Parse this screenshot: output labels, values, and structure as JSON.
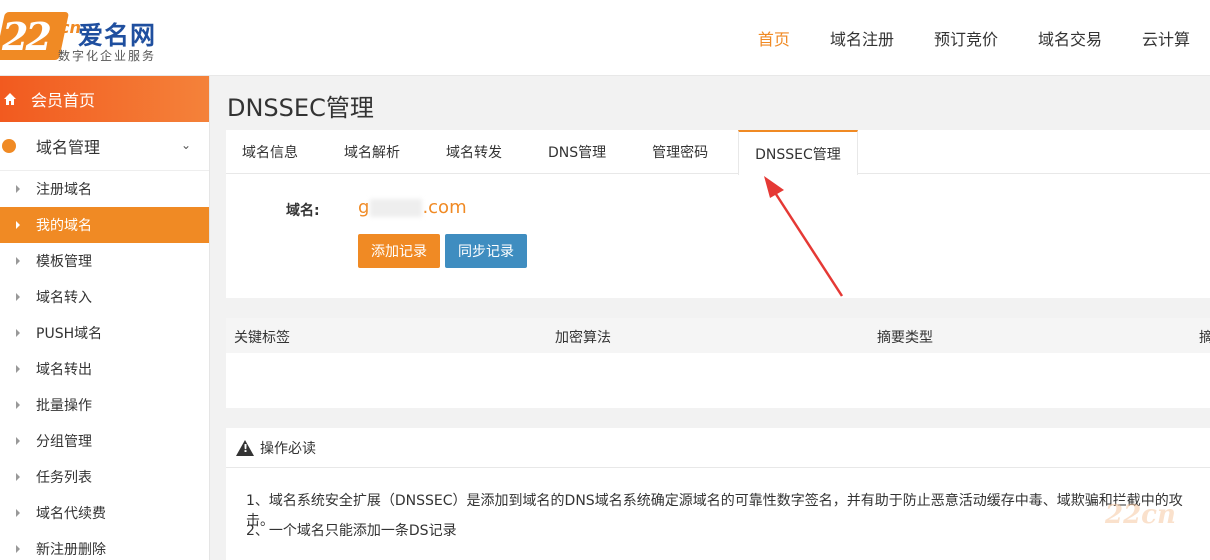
{
  "header": {
    "logo_number": "22",
    "logo_cn": "cn",
    "logo_brand": "爱名网",
    "logo_slogan": "数字化企业服务",
    "nav": [
      "首页",
      "域名注册",
      "预订竞价",
      "域名交易",
      "云计算"
    ],
    "nav_active": "首页"
  },
  "sidebar": {
    "home_label": "会员首页",
    "group_label": "域名管理",
    "items": [
      "注册域名",
      "我的域名",
      "模板管理",
      "域名转入",
      "PUSH域名",
      "域名转出",
      "批量操作",
      "分组管理",
      "任务列表",
      "域名代续费",
      "新注册删除"
    ],
    "active_item": "我的域名"
  },
  "main": {
    "page_title": "DNSSEC管理",
    "tabs": [
      "域名信息",
      "域名解析",
      "域名转发",
      "DNS管理",
      "管理密码",
      "DNSSEC管理"
    ],
    "active_tab": "DNSSEC管理",
    "domain_label": "域名:",
    "domain_prefix": "g",
    "domain_suffix": ".com",
    "add_button": "添加记录",
    "sync_button": "同步记录",
    "table_headers": [
      "关键标签",
      "加密算法",
      "摘要类型",
      "摘"
    ],
    "notice_title": "操作必读",
    "notice_lines": [
      "1、域名系统安全扩展（DNSSEC）是添加到域名的DNS域名系统确定源域名的可靠性数字签名，并有助于防止恶意活动缓存中毒、域欺骗和拦截中的攻击。",
      "2、一个域名只能添加一条DS记录"
    ]
  },
  "watermark": "22cn",
  "colors": {
    "accent": "#f08a24",
    "sync_button": "#3f8dc0",
    "brand_blue": "#1f4f9f",
    "annotation_arrow": "#e53935"
  }
}
